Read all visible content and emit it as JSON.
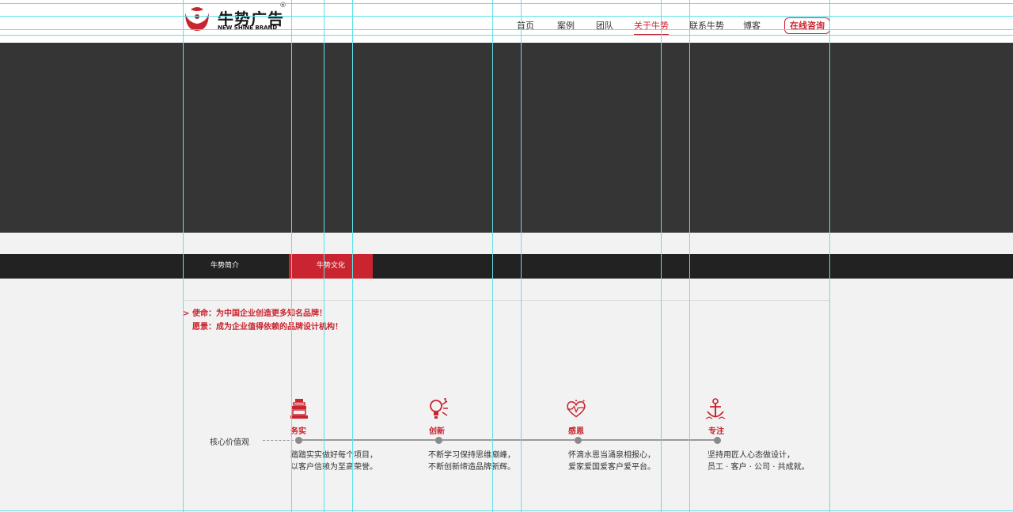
{
  "logo": {
    "brand": "牛势广告",
    "reg": "®",
    "sub": "NEW SHINE BRAND"
  },
  "nav": {
    "items": [
      {
        "label": "首页"
      },
      {
        "label": "案例"
      },
      {
        "label": "团队"
      },
      {
        "label": "关于牛势",
        "active": true
      },
      {
        "label": "联系牛势"
      },
      {
        "label": "博客"
      }
    ],
    "consult": "在线咨询"
  },
  "tabs": [
    {
      "label": "牛势简介"
    },
    {
      "label": "牛势文化",
      "active": true
    }
  ],
  "mission": {
    "arrow": ">",
    "line1": "使命：为中国企业创造更多知名品牌！",
    "line2": "愿景：成为企业值得依赖的品牌设计机构！"
  },
  "core_values": {
    "label": "核心价值观",
    "items": [
      {
        "title": "务实",
        "icon": "lantern-icon",
        "desc1": "踏踏实实做好每个项目，",
        "desc2": "以客户信赖为至高荣誉。"
      },
      {
        "title": "创新",
        "icon": "lightbulb-icon",
        "desc1": "不断学习保持思维巅峰，",
        "desc2": "不断创新缔造品牌新辉。"
      },
      {
        "title": "感恩",
        "icon": "heart-icon",
        "desc1": "怀滴水恩当涌泉相报心，",
        "desc2": "爱家爱国爱客户爱平台。"
      },
      {
        "title": "专注",
        "icon": "anchor-icon",
        "desc1": "坚持用匠人心态做设计，",
        "desc2": "员工 · 客户 · 公司 · 共成就。"
      }
    ]
  },
  "colors": {
    "accent": "#c9242f",
    "banner": "#353535",
    "tabbar": "#222222",
    "guide": "#5ee1e8"
  }
}
